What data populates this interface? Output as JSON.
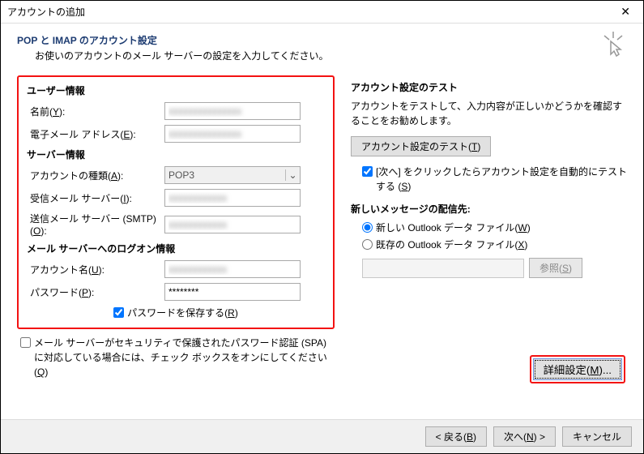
{
  "window": {
    "title": "アカウントの追加"
  },
  "header": {
    "heading": "POP と IMAP のアカウント設定",
    "sub": "お使いのアカウントのメール サーバーの設定を入力してください。"
  },
  "left": {
    "section_user": "ユーザー情報",
    "name_label_pre": "名前(",
    "name_label_u": "Y",
    "name_label_post": "):",
    "email_label_pre": "電子メール アドレス(",
    "email_label_u": "E",
    "email_label_post": "):",
    "section_server": "サーバー情報",
    "type_label_pre": "アカウントの種類(",
    "type_label_u": "A",
    "type_label_post": "):",
    "type_value": "POP3",
    "incoming_label_pre": "受信メール サーバー(",
    "incoming_label_u": "I",
    "incoming_label_post": "):",
    "outgoing_label_pre": "送信メール サーバー (SMTP)(",
    "outgoing_label_u": "O",
    "outgoing_label_post": "):",
    "section_logon": "メール サーバーへのログオン情報",
    "account_label_pre": "アカウント名(",
    "account_label_u": "U",
    "account_label_post": "):",
    "password_label_pre": "パスワード(",
    "password_label_u": "P",
    "password_label_post": "):",
    "password_value": "********",
    "save_pw_pre": "パスワードを保存する(",
    "save_pw_u": "R",
    "save_pw_post": ")",
    "spa_pre": "メール サーバーがセキュリティで保護されたパスワード認証 (SPA) に対応している場合には、チェック ボックスをオンにしてください(",
    "spa_u": "Q",
    "spa_post": ")"
  },
  "right": {
    "test_heading": "アカウント設定のテスト",
    "test_desc": "アカウントをテストして、入力内容が正しいかどうかを確認することをお勧めします。",
    "test_btn_pre": "アカウント設定のテスト(",
    "test_btn_u": "T",
    "test_btn_post": ")",
    "autotest_pre": "[次へ] をクリックしたらアカウント設定を自動的にテストする (",
    "autotest_u": "S",
    "autotest_post": ")",
    "deliver_heading": "新しいメッセージの配信先:",
    "new_pst_pre": "新しい Outlook データ ファイル(",
    "new_pst_u": "W",
    "new_pst_post": ")",
    "exist_pst_pre": "既存の Outlook データ ファイル(",
    "exist_pst_u": "X",
    "exist_pst_post": ")",
    "browse_pre": "参照(",
    "browse_u": "S",
    "browse_post": ")",
    "more_pre": "詳細設定(",
    "more_u": "M",
    "more_post": ")..."
  },
  "footer": {
    "back_pre": "< 戻る(",
    "back_u": "B",
    "back_post": ")",
    "next_pre": "次へ(",
    "next_u": "N",
    "next_post": ") >",
    "cancel": "キャンセル"
  }
}
